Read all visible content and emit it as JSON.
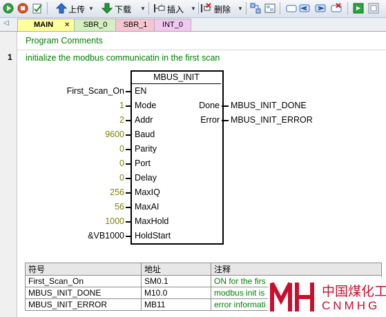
{
  "toolbar": {
    "upload_label": "上传",
    "download_label": "下载",
    "insert_label": "插入",
    "delete_label": "删除"
  },
  "tabs": {
    "scroll_arrow": "◁",
    "close_glyph": "✕",
    "items": [
      "MAIN",
      "SBR_0",
      "SBR_1",
      "INT_0"
    ]
  },
  "editor": {
    "program_comments": "Program Comments",
    "network_number": "1",
    "network_comment": "initialize the modbus communicatin in the first scan"
  },
  "block": {
    "title": "MBUS_INIT",
    "inputs": [
      {
        "pin": "EN",
        "value": "First_Scan_On"
      },
      {
        "pin": "Mode",
        "value": "1"
      },
      {
        "pin": "Addr",
        "value": "2"
      },
      {
        "pin": "Baud",
        "value": "9600"
      },
      {
        "pin": "Parity",
        "value": "0"
      },
      {
        "pin": "Port",
        "value": "0"
      },
      {
        "pin": "Delay",
        "value": "0"
      },
      {
        "pin": "MaxIQ",
        "value": "256"
      },
      {
        "pin": "MaxAI",
        "value": "56"
      },
      {
        "pin": "MaxHold",
        "value": "1000"
      },
      {
        "pin": "HoldStart",
        "value": "&VB1000"
      }
    ],
    "outputs": [
      {
        "pin": "Done",
        "value": "MBUS_INIT_DONE"
      },
      {
        "pin": "Error",
        "value": "MBUS_INIT_ERROR"
      }
    ]
  },
  "symbol_table": {
    "headers": [
      "符号",
      "地址",
      "注释"
    ],
    "rows": [
      [
        "First_Scan_On",
        "SM0.1",
        "ON for the firs"
      ],
      [
        "MBUS_INIT_DONE",
        "M10.0",
        "modbus init is"
      ],
      [
        "MBUS_INIT_ERROR",
        "MB11",
        "error informati"
      ]
    ]
  },
  "watermark": {
    "cn": "中国煤化工",
    "en": "CNMHG",
    "color": "#c8102e"
  }
}
